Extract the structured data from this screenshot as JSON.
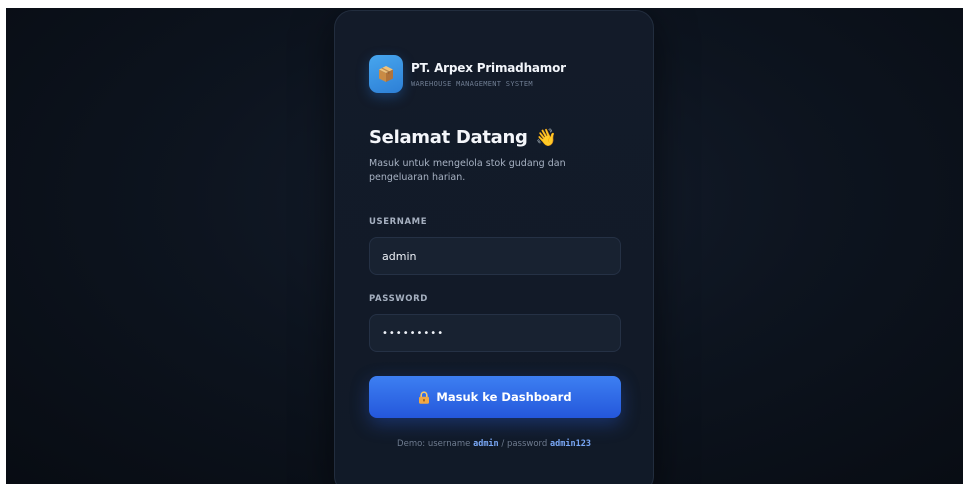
{
  "brand": {
    "name": "PT. Arpex Primadhamor",
    "subtitle": "WAREHOUSE MANAGEMENT SYSTEM",
    "logo_icon": "package-box-icon"
  },
  "welcome": {
    "title": "Selamat Datang",
    "emoji": "👋",
    "subtitle": "Masuk untuk mengelola stok gudang dan pengeluaran harian."
  },
  "form": {
    "username_label": "USERNAME",
    "username_value": "admin",
    "password_label": "PASSWORD",
    "password_value": "•••••••••",
    "submit_label": "Masuk ke Dashboard",
    "submit_icon": "lock-icon"
  },
  "demo": {
    "prefix": "Demo: username",
    "username": "admin",
    "separator": "/ password",
    "password": "admin123"
  },
  "colors": {
    "background": "#0d141f",
    "card": "#131b29",
    "accent": "#2f6be6",
    "code": "#79a7f5"
  }
}
